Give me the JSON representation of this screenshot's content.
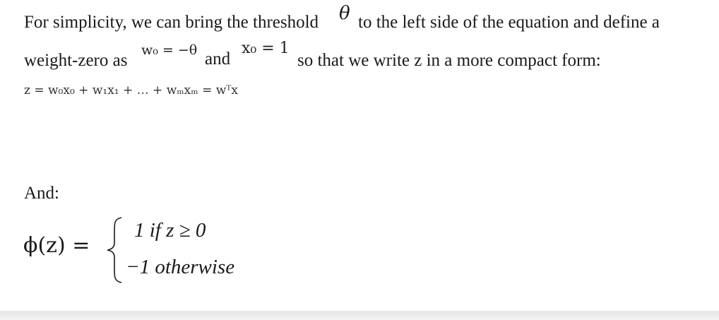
{
  "paragraph": {
    "line1_before": "For simplicity, we can bring the threshold",
    "theta": "θ",
    "line1_after": "to the left side of the equation and define a",
    "line2_before": "weight-zero as",
    "w0_def": "w₀ = −θ",
    "and": "and",
    "x0_def": "x₀ = 1",
    "line2_after": "so that we write z in a more compact form:"
  },
  "equation": {
    "z_expansion": "z = w₀x₀ + w₁x₁ + … + wₘxₘ = wᵀx"
  },
  "and_label": "And:",
  "piecewise": {
    "lhs": "ϕ(z) =",
    "case1": "1 if z ≥ 0",
    "case2": "−1 otherwise"
  }
}
